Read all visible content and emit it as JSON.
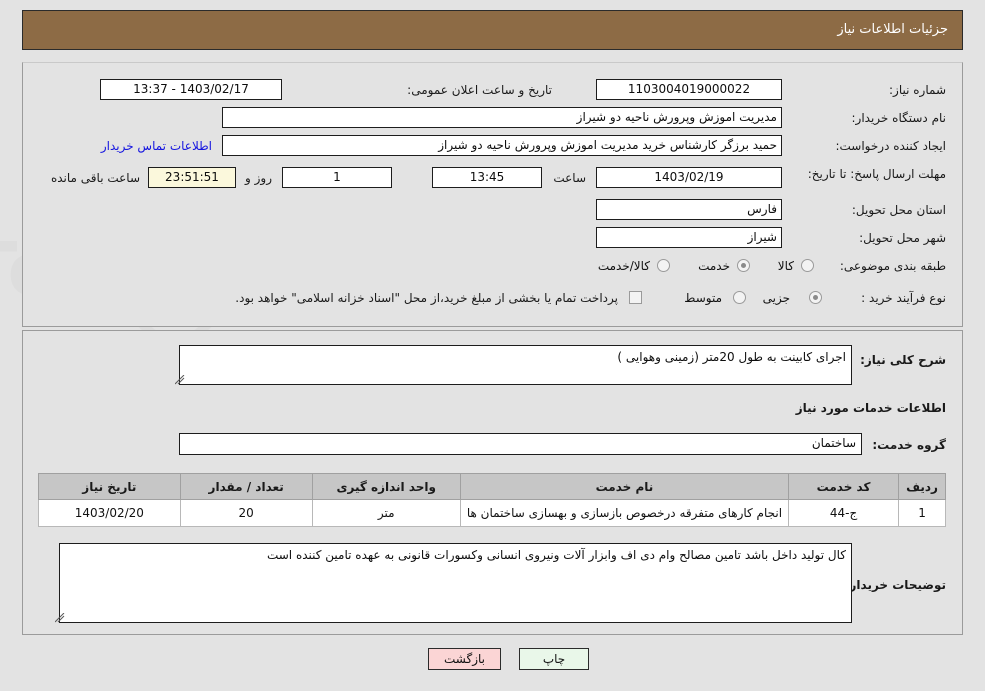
{
  "header": {
    "title": "جزئیات اطلاعات نیاز"
  },
  "form": {
    "need_number_label": "شماره نیاز:",
    "need_number": "1103004019000022",
    "announce_label": "تاریخ و ساعت اعلان عمومی:",
    "announce_value": "1403/02/17 - 13:37",
    "buyer_org_label": "نام دستگاه خریدار:",
    "buyer_org": "مدیریت اموزش وپرورش ناحیه دو شیراز",
    "requester_label": "ایجاد کننده درخواست:",
    "requester": "حمید برزگر کارشناس خرید مدیریت اموزش وپرورش ناحیه دو شیراز",
    "contact_link": "اطلاعات تماس خریدار",
    "deadline_label": "مهلت ارسال پاسخ: تا تاریخ:",
    "deadline_date": "1403/02/19",
    "hour_label": "ساعت",
    "deadline_time": "13:45",
    "days_remaining": "1",
    "day_and_label": "روز و",
    "countdown": "23:51:51",
    "remaining_label": "ساعت باقی مانده",
    "province_label": "استان محل تحویل:",
    "province": "فارس",
    "city_label": "شهر محل تحویل:",
    "city": "شیراز",
    "category_label": "طبقه بندی موضوعی:",
    "category_options": [
      "کالا",
      "خدمت",
      "کالا/خدمت"
    ],
    "category_selected": "خدمت",
    "process_label": "نوع فرآیند خرید :",
    "process_options": [
      "جزیی",
      "متوسط"
    ],
    "process_selected": "جزیی",
    "treasury_note": "پرداخت تمام یا بخشی از مبلغ خرید،از محل \"اسناد خزانه اسلامی\" خواهد بود."
  },
  "details": {
    "general_desc_label": "شرح کلی نیاز:",
    "general_desc": "اجرای کابینت به طول 20متر (زمینی وهوایی )",
    "services_heading": "اطلاعات خدمات مورد نیاز",
    "service_group_label": "گروه خدمت:",
    "service_group": "ساختمان",
    "notes_label": "توضیحات خریدار:",
    "notes": "کال تولید داخل باشد تامین مصالح وام دی اف وابزار آلات ونیروی انسانی وکسورات قانونی به عهده تامین کننده است"
  },
  "table": {
    "columns": [
      "ردیف",
      "کد خدمت",
      "نام خدمت",
      "واحد اندازه گیری",
      "تعداد / مقدار",
      "تاریخ نیاز"
    ],
    "rows": [
      {
        "row": "1",
        "code": "ج-44",
        "name": "انجام کارهای متفرقه درخصوص بازسازی و بهسازی ساختمان ها",
        "unit": "متر",
        "qty": "20",
        "date": "1403/02/20"
      }
    ]
  },
  "buttons": {
    "print": "چاپ",
    "back": "بازگشت"
  }
}
